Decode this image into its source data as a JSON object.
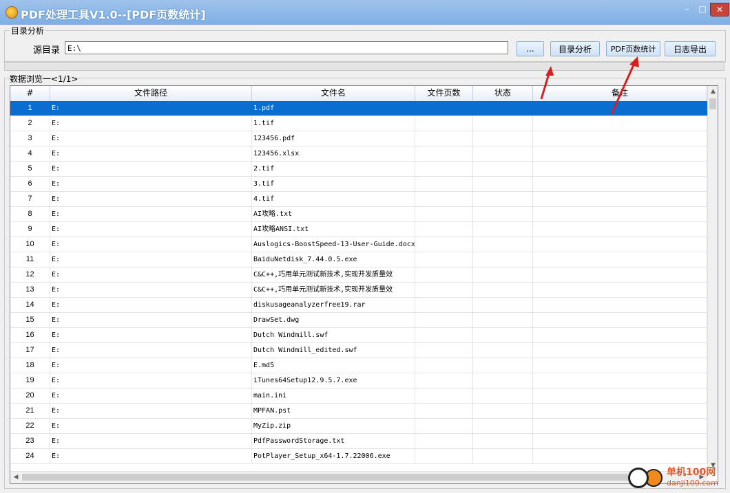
{
  "window": {
    "title": "PDF处理工具V1.0--[PDF页数统计]",
    "minimize": "–",
    "maximize": "□",
    "close": "✕"
  },
  "directory_group": {
    "legend": "目录分析",
    "source_label": "源目录",
    "source_value": "E:\\",
    "browse_label": "...",
    "analyze_label": "目录分析",
    "pdf_count_label": "PDF页数统计",
    "log_export_label": "日志导出"
  },
  "browse_group": {
    "legend": "数据浏览一<1/1>"
  },
  "table": {
    "columns": [
      "#",
      "文件路径",
      "文件名",
      "文件页数",
      "状态",
      "备注"
    ],
    "selected_row": 1,
    "rows": [
      {
        "n": "1",
        "path": "E:",
        "name": "1.pdf"
      },
      {
        "n": "2",
        "path": "E:",
        "name": "1.tif"
      },
      {
        "n": "3",
        "path": "E:",
        "name": "123456.pdf"
      },
      {
        "n": "4",
        "path": "E:",
        "name": "123456.xlsx"
      },
      {
        "n": "5",
        "path": "E:",
        "name": "2.tif"
      },
      {
        "n": "6",
        "path": "E:",
        "name": "3.tif"
      },
      {
        "n": "7",
        "path": "E:",
        "name": "4.tif"
      },
      {
        "n": "8",
        "path": "E:",
        "name": "AI攻略.txt"
      },
      {
        "n": "9",
        "path": "E:",
        "name": "AI攻略ANSI.txt"
      },
      {
        "n": "10",
        "path": "E:",
        "name": "Auslogics-BoostSpeed-13-User-Guide.docx"
      },
      {
        "n": "11",
        "path": "E:",
        "name": "BaiduNetdisk_7.44.0.5.exe"
      },
      {
        "n": "12",
        "path": "E:",
        "name": "C&C++,巧用单元测试新技术,实现开发质量效"
      },
      {
        "n": "13",
        "path": "E:",
        "name": "C&C++,巧用单元测试新技术,实现开发质量效"
      },
      {
        "n": "14",
        "path": "E:",
        "name": "diskusageanalyzerfree19.rar"
      },
      {
        "n": "15",
        "path": "E:",
        "name": "DrawSet.dwg"
      },
      {
        "n": "16",
        "path": "E:",
        "name": "Dutch Windmill.swf"
      },
      {
        "n": "17",
        "path": "E:",
        "name": "Dutch Windmill_edited.swf"
      },
      {
        "n": "18",
        "path": "E:",
        "name": "E.md5"
      },
      {
        "n": "19",
        "path": "E:",
        "name": "iTunes64Setup12.9.5.7.exe"
      },
      {
        "n": "20",
        "path": "E:",
        "name": "main.ini"
      },
      {
        "n": "21",
        "path": "E:",
        "name": "MPFAN.pst"
      },
      {
        "n": "22",
        "path": "E:",
        "name": "MyZip.zip"
      },
      {
        "n": "23",
        "path": "E:",
        "name": "PdfPasswordStorage.txt"
      },
      {
        "n": "24",
        "path": "E:",
        "name": "PotPlayer_Setup_x64-1.7.22006.exe"
      }
    ]
  },
  "watermark": {
    "text": "单机100网",
    "sub": "danji100.com"
  },
  "colors": {
    "selection": "#0a6ed1",
    "arrow": "#d81e1e",
    "titlebar": "#8db7e8"
  }
}
